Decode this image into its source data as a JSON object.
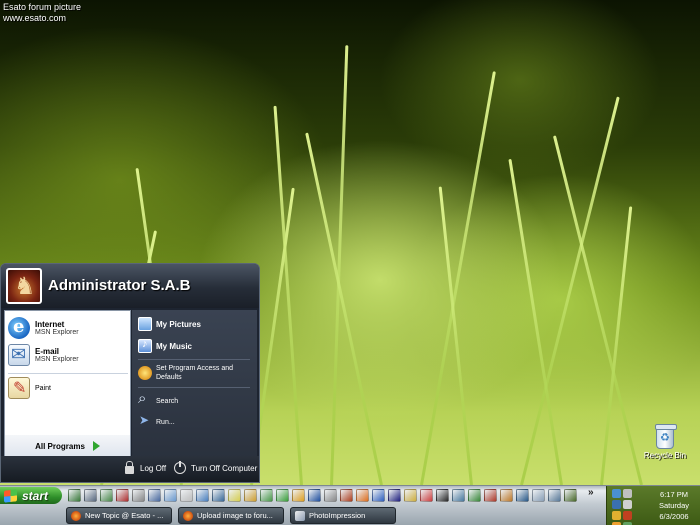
{
  "watermark": {
    "line1": "Esato forum picture",
    "line2": "www.esato.com"
  },
  "desktop": {
    "recycle_bin_label": "Recycle Bin"
  },
  "start_menu": {
    "user_name": "Administrator S.A.B",
    "left_items": [
      {
        "title": "Internet",
        "subtitle": "MSN Explorer",
        "icon": "ie-icon"
      },
      {
        "title": "E-mail",
        "subtitle": "MSN Explorer",
        "icon": "mail-icon"
      },
      {
        "title": "Paint",
        "icon": "paint-icon"
      }
    ],
    "all_programs_label": "All Programs",
    "right_items": [
      {
        "label": "My Pictures",
        "icon": "my-pictures-icon"
      },
      {
        "label": "My Music",
        "icon": "my-music-icon"
      },
      {
        "label_line1": "Set Program Access and",
        "label_line2": "Defaults",
        "icon": "set-program-access-icon"
      },
      {
        "label": "Search",
        "icon": "search-icon"
      },
      {
        "label": "Run...",
        "icon": "run-icon"
      }
    ],
    "footer": {
      "log_off": "Log Off",
      "turn_off": "Turn Off Computer"
    }
  },
  "taskbar": {
    "start_label": "start",
    "overflow": "»",
    "tasks": [
      {
        "label": "New Topic @ Esato - ...",
        "icon": "firefox-icon"
      },
      {
        "label": "Upload image to foru...",
        "icon": "firefox-icon"
      },
      {
        "label": "PhotoImpression",
        "icon": "photoimpression-icon"
      }
    ],
    "clock": {
      "time": "6:17 PM",
      "day": "Saturday",
      "date": "6/3/2006"
    }
  },
  "colors": {
    "quick_launch": [
      "#3a7a3a",
      "#5a6a80",
      "#4a8a4a",
      "#b03030",
      "#8a8a8a",
      "#4a6aa0",
      "#6a9ad0",
      "#c0c0c0",
      "#4a80c0",
      "#3a6a9a",
      "#d8d050",
      "#d0a030",
      "#4a9a4a",
      "#3aa03a",
      "#e0a020",
      "#2050a0",
      "#8a8a8a",
      "#b04020",
      "#e07020",
      "#3060c0",
      "#202080",
      "#d0b040",
      "#d04040",
      "#2a2a2a",
      "#4a7aa0",
      "#3a8a3a",
      "#b03a2a",
      "#c07a2a",
      "#2a5a8a",
      "#8aa0b8",
      "#5a7a9a",
      "#4a6a2a"
    ],
    "tray": [
      "#4a90d0",
      "#c0c0c0",
      "#3a70b0",
      "#d0d0d0",
      "#e0b030",
      "#c04020",
      "#f0a030",
      "#60a060",
      "#4a4a4a"
    ]
  }
}
